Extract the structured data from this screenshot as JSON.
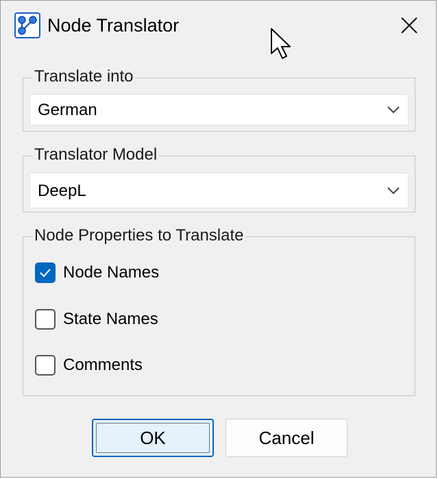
{
  "window": {
    "title": "Node Translator",
    "app_icon": "node-graph-icon",
    "close_icon": "close-icon"
  },
  "translate_into": {
    "legend": "Translate into",
    "selected": "German"
  },
  "translator_model": {
    "legend": "Translator Model",
    "selected": "DeepL"
  },
  "node_properties": {
    "legend": "Node Properties to Translate",
    "options": [
      {
        "label": "Node Names",
        "checked": true
      },
      {
        "label": "State Names",
        "checked": false
      },
      {
        "label": "Comments",
        "checked": false
      }
    ]
  },
  "buttons": {
    "ok": "OK",
    "cancel": "Cancel"
  },
  "colors": {
    "accent": "#0067c0",
    "dialog_bg": "#f0f0f0"
  }
}
